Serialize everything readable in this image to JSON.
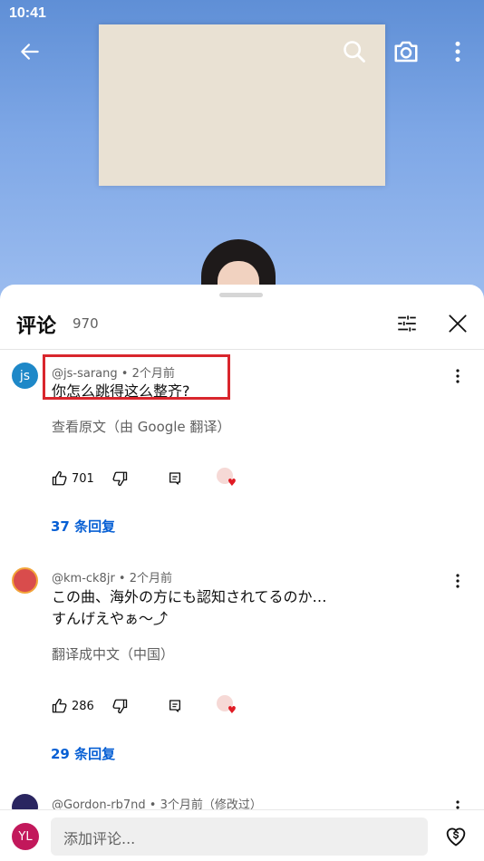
{
  "status_bar": {
    "time": "10:41"
  },
  "comments_panel": {
    "title": "评论",
    "count": "970"
  },
  "comments": [
    {
      "avatar_text": "js",
      "avatar_color": "#1e88c8",
      "author": "@js-sarang",
      "time": "2个月前",
      "text_lines": [
        "你怎么跳得这么整齐?"
      ],
      "translate_label": "查看原文（由 Google 翻译）",
      "likes": "701",
      "replies_label": "37 条回复"
    },
    {
      "avatar_text": "",
      "avatar_color": "#d94c4c",
      "author": "@km-ck8jr",
      "time": "2个月前",
      "text_lines": [
        "この曲、海外の方にも認知されてるのか…",
        "すんげえやぁ〜⤴︎"
      ],
      "translate_label": "翻译成中文（中国）",
      "likes": "286",
      "replies_label": "29 条回复"
    },
    {
      "avatar_text": "",
      "avatar_color": "#2a2560",
      "author": "@Gordon-rb7nd",
      "time": "3个月前（修改过）"
    }
  ],
  "add_comment": {
    "avatar_text": "YL",
    "placeholder": "添加评论..."
  },
  "separator": " • ",
  "colors": {
    "link": "#065fd4",
    "highlight_box": "#d9262d"
  }
}
